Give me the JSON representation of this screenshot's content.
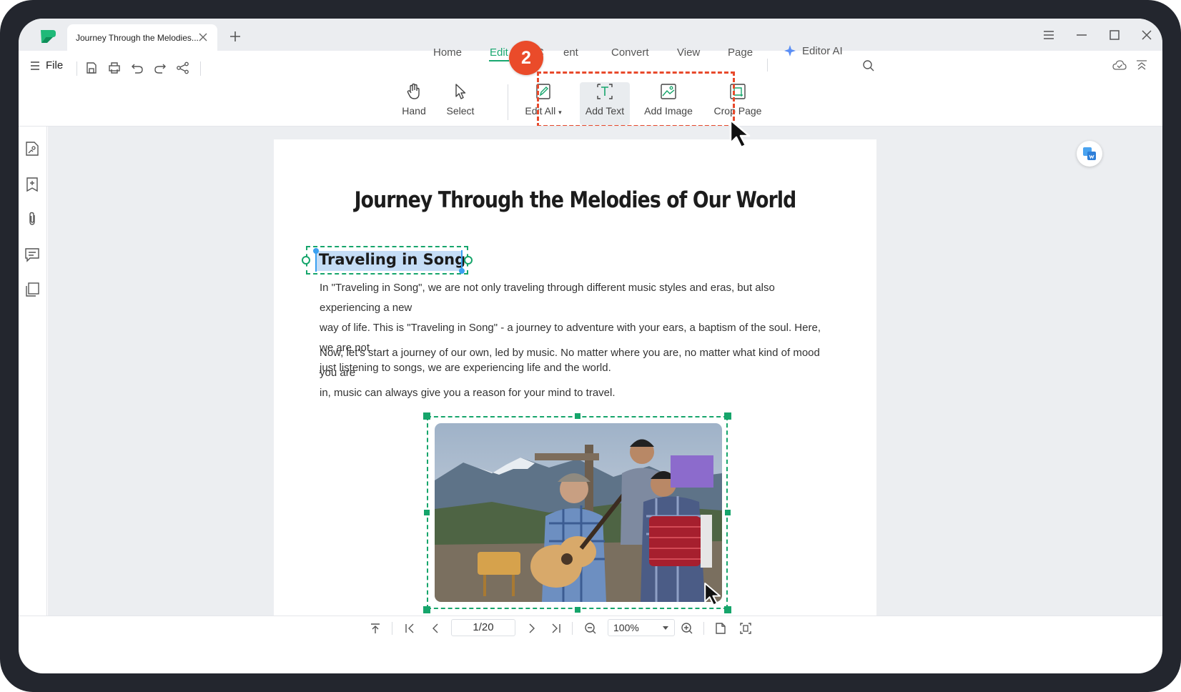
{
  "tab": {
    "title": "Journey Through the Melodies..."
  },
  "menu": {
    "file_label": "File",
    "tabs": [
      "Home",
      "Edit",
      "Content",
      "Convert",
      "View",
      "Page"
    ],
    "tab_visible": [
      "Home",
      "Edit",
      "C",
      "ent",
      "Convert",
      "View",
      "Page"
    ],
    "ai_label": "Editor AI"
  },
  "step_badge": "2",
  "toolbar": {
    "hand": "Hand",
    "select": "Select",
    "edit_all": "Edit All",
    "add_text": "Add Text",
    "add_image": "Add Image",
    "crop_page": "Crop Page"
  },
  "document": {
    "title": "Journey Through the Melodies of Our World",
    "heading": "Traveling in Song",
    "paragraph1_lines": [
      "In \"Traveling in Song\", we are not only traveling through different music styles and eras, but also experiencing a new",
      "way of life. This is \"Traveling in Song\" - a journey to adventure with your ears, a baptism of the soul. Here, we are not",
      "just listening to songs, we are experiencing life and the world."
    ],
    "paragraph2_lines": [
      "Now, let's start a journey of our own, led by music. No matter where you are, no matter what kind of mood you are",
      "in, music can always give you a reason for your mind to travel."
    ]
  },
  "statusbar": {
    "page": "1/20",
    "zoom": "100%"
  },
  "colors": {
    "accent": "#19a870",
    "highlight": "#e84a2c",
    "selection": "#c5ddf6"
  }
}
